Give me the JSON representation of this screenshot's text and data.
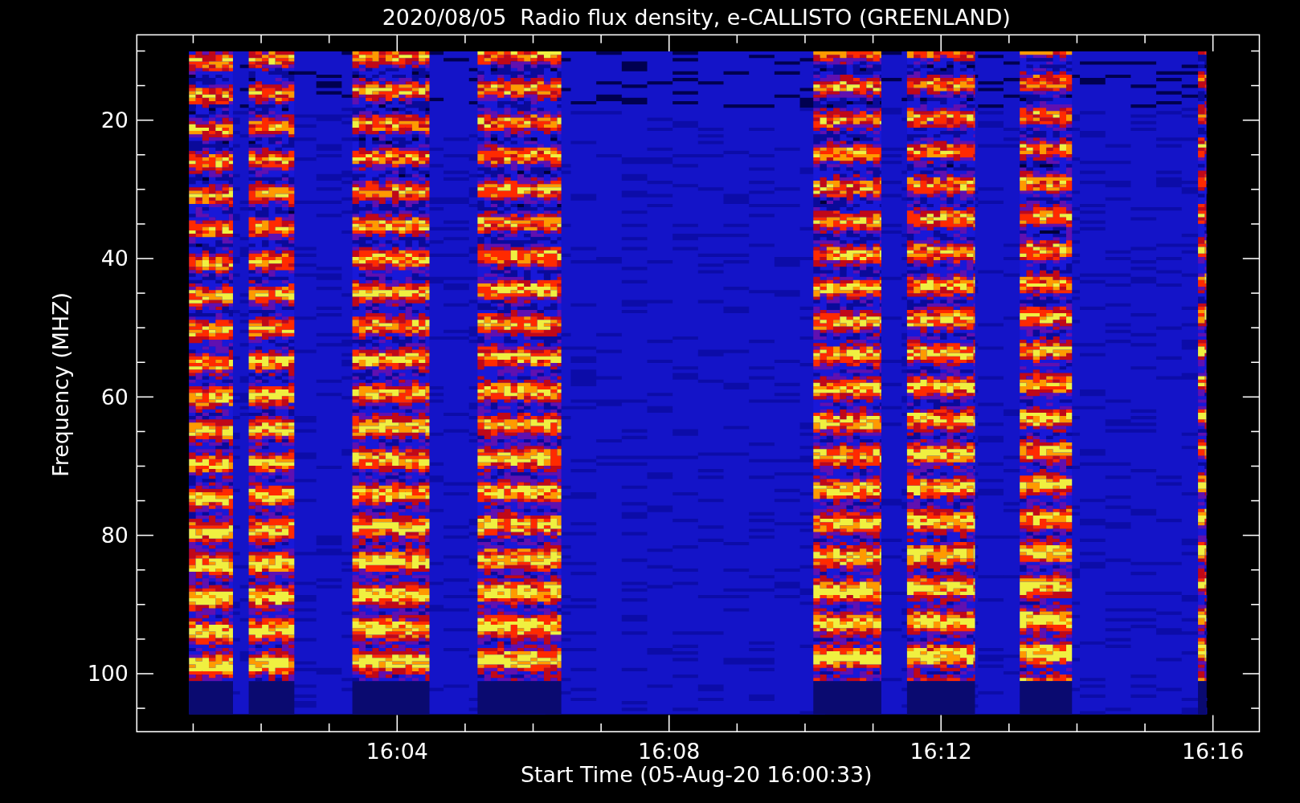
{
  "title": "2020/08/05  Radio flux density, e-CALLISTO (GREENLAND)",
  "y_axis": {
    "label": "Frequency (MHZ)",
    "ticks": [
      "20",
      "40",
      "60",
      "80",
      "100"
    ]
  },
  "x_axis": {
    "label": "Start Time (05-Aug-20 16:00:33)",
    "ticks": [
      "16:04",
      "16:08",
      "16:12",
      "16:16"
    ]
  }
}
